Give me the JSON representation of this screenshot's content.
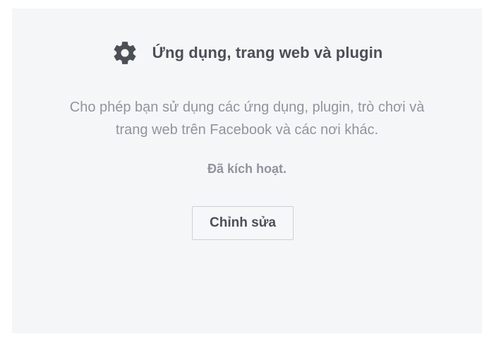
{
  "section": {
    "icon": "gear-icon",
    "title": "Ứng dụng, trang web và plugin",
    "description_line1": "Cho phép bạn sử dụng các ứng dụng, plugin, trò chơi và",
    "description_line2": "trang web trên Facebook và các nơi khác.",
    "status": "Đã kích hoạt.",
    "edit_label": "Chỉnh sửa"
  },
  "colors": {
    "panel_bg": "#f5f6f8",
    "title_text": "#4b4f56",
    "muted_text": "#90949c",
    "button_border": "#ced0d4"
  }
}
